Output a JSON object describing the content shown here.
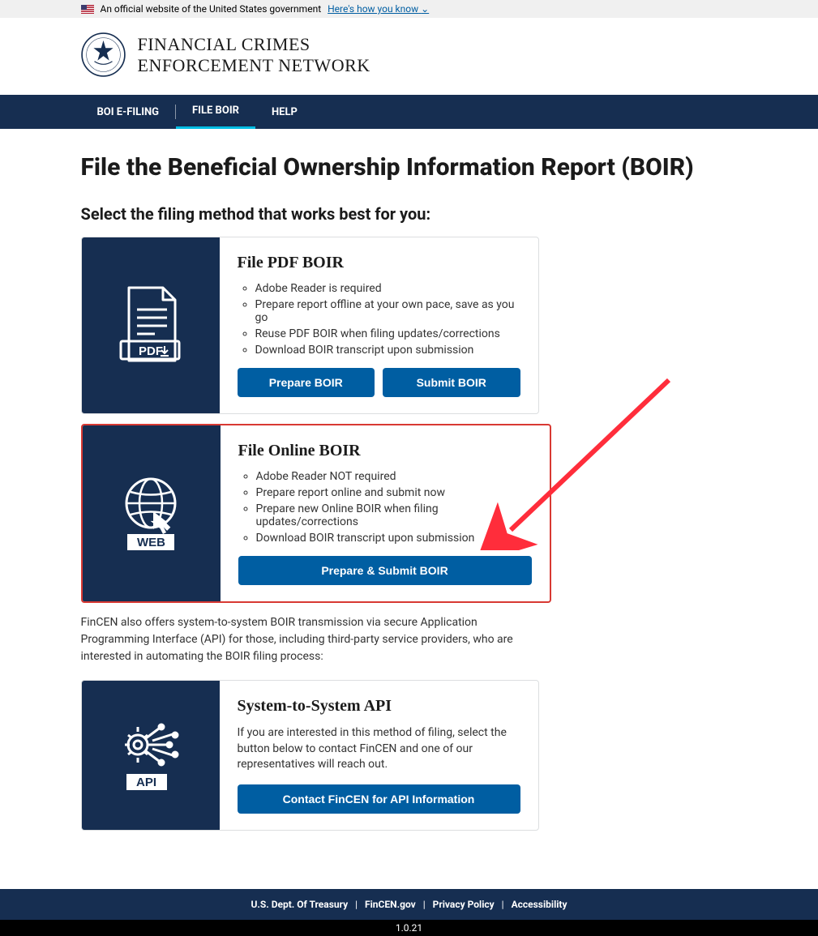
{
  "banner": {
    "text": "An official website of the United States government",
    "link_text": "Here's how you know"
  },
  "site": {
    "title_line1": "FINANCIAL CRIMES",
    "title_line2": "ENFORCEMENT NETWORK"
  },
  "nav": {
    "items": [
      {
        "label": "BOI E-FILING"
      },
      {
        "label": "FILE BOIR"
      },
      {
        "label": "HELP"
      }
    ]
  },
  "page": {
    "heading": "File the Beneficial Ownership Information Report (BOIR)",
    "subheading": "Select the filing method that works best for you:",
    "note": "FinCEN also offers system-to-system BOIR transmission via secure Application Programming Interface (API) for those, including third-party service providers, who are interested in automating the BOIR filing process:"
  },
  "cards": {
    "pdf": {
      "icon_label": "PDF",
      "title": "File PDF BOIR",
      "bullets": [
        "Adobe Reader is required",
        "Prepare report offline at your own pace, save as you go",
        "Reuse PDF BOIR when filing updates/corrections",
        "Download BOIR transcript upon submission"
      ],
      "btn1": "Prepare BOIR",
      "btn2": "Submit BOIR"
    },
    "web": {
      "icon_label": "WEB",
      "title": "File Online BOIR",
      "bullets": [
        "Adobe Reader NOT required",
        "Prepare report online and submit now",
        "Prepare new Online BOIR when filing updates/corrections",
        "Download BOIR transcript upon submission"
      ],
      "btn1": "Prepare & Submit BOIR"
    },
    "api": {
      "icon_label": "API",
      "title": "System-to-System API",
      "desc": "If you are interested in this method of filing, select the button below to contact FinCEN and one of our representatives will reach out.",
      "btn1": "Contact FinCEN for API Information"
    }
  },
  "footer": {
    "links": [
      "U.S. Dept. Of Treasury",
      "FinCEN.gov",
      "Privacy Policy",
      "Accessibility"
    ],
    "version": "1.0.21"
  },
  "annotation": {
    "arrow_color": "#ff2d3b"
  }
}
